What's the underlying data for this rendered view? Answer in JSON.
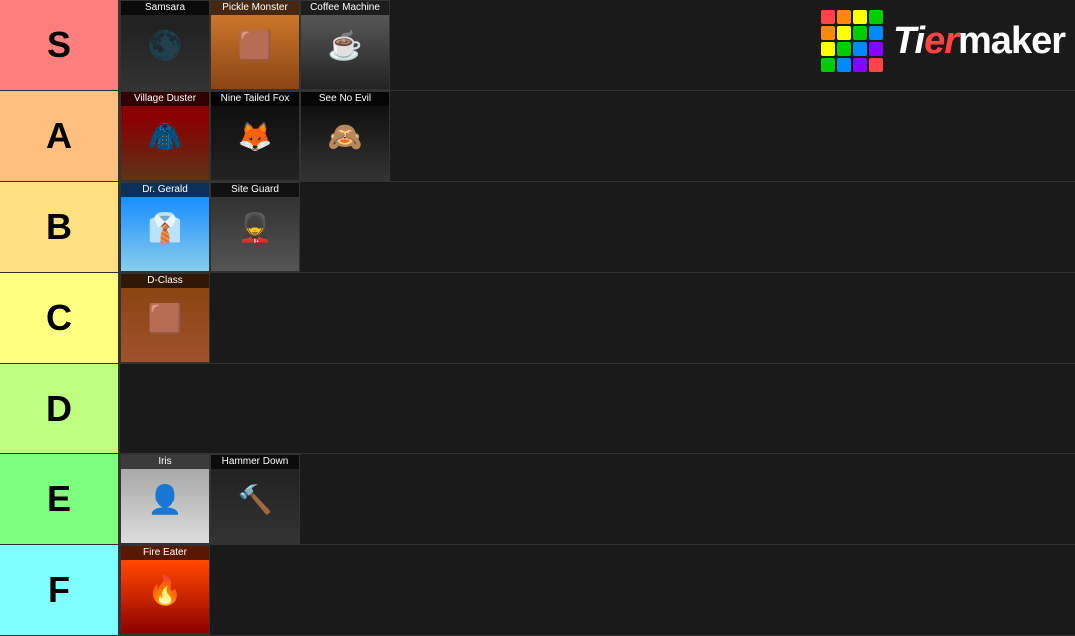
{
  "logo": {
    "text": "TierMaker",
    "grid_colors": [
      "#ff4444",
      "#ff8800",
      "#ffff00",
      "#00cc00",
      "#ff8800",
      "#ffff00",
      "#00cc00",
      "#0088ff",
      "#ffff00",
      "#00cc00",
      "#0088ff",
      "#8800ff",
      "#00cc00",
      "#0088ff",
      "#8800ff",
      "#ff4444"
    ]
  },
  "tiers": [
    {
      "id": "s",
      "label": "S",
      "color": "#ff7f7f",
      "items": [
        {
          "id": "samsara",
          "name": "Samsara",
          "char_class": "char-samsara",
          "emoji": "🌑"
        },
        {
          "id": "pickle-monster",
          "name": "Pickle Monster",
          "char_class": "char-pickle-monster",
          "emoji": "🟫"
        },
        {
          "id": "coffee-machine",
          "name": "Coffee Machine",
          "char_class": "char-coffee-machine",
          "emoji": "☕"
        }
      ]
    },
    {
      "id": "a",
      "label": "A",
      "color": "#ffbf7f",
      "items": [
        {
          "id": "village-duster",
          "name": "Village Duster",
          "char_class": "char-village-duster",
          "emoji": "🧥"
        },
        {
          "id": "nine-tailed-fox",
          "name": "Nine Tailed Fox",
          "char_class": "char-nine-tailed-fox",
          "emoji": "🦊"
        },
        {
          "id": "see-no-evil",
          "name": "See No Evil",
          "char_class": "char-see-no-evil",
          "emoji": "🙈"
        }
      ]
    },
    {
      "id": "b",
      "label": "B",
      "color": "#ffdf7f",
      "items": [
        {
          "id": "dr-gerald",
          "name": "Dr. Gerald",
          "char_class": "char-dr-gerald",
          "emoji": "👔"
        },
        {
          "id": "site-guard",
          "name": "Site Guard",
          "char_class": "char-site-guard",
          "emoji": "💂"
        }
      ]
    },
    {
      "id": "c",
      "label": "C",
      "color": "#ffff7f",
      "items": [
        {
          "id": "d-class",
          "name": "D-Class",
          "char_class": "char-d-class",
          "emoji": "🟫"
        }
      ]
    },
    {
      "id": "d",
      "label": "D",
      "color": "#bfff7f",
      "items": []
    },
    {
      "id": "e",
      "label": "E",
      "color": "#7fff7f",
      "items": [
        {
          "id": "iris",
          "name": "Iris",
          "char_class": "char-iris",
          "emoji": "👤"
        },
        {
          "id": "hammer-down",
          "name": "Hammer Down",
          "char_class": "char-hammer-down",
          "emoji": "🔨"
        }
      ]
    },
    {
      "id": "f",
      "label": "F",
      "color": "#7fffff",
      "items": [
        {
          "id": "fire-eater",
          "name": "Fire Eater",
          "char_class": "char-fire-eater",
          "emoji": "🔥"
        }
      ]
    }
  ]
}
